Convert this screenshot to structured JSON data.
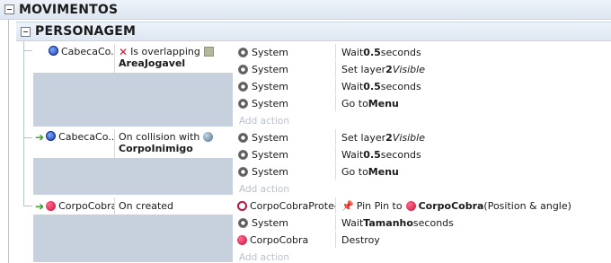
{
  "groups": {
    "main_title": "MOVIMENTOS",
    "sub_title": "PERSONAGEM"
  },
  "events": [
    {
      "object": "CabecaCo...",
      "icon": "blue-sprite-icon",
      "trigger": false,
      "condition_prefix": "Is overlapping",
      "condition_target": "AreaJogavel",
      "condition_icon": "x-icon",
      "target_icon": "sprite-thumbnail-icon",
      "actions": [
        {
          "object": "System",
          "icon": "gear-icon",
          "text_a": "Wait ",
          "bold": "0.5",
          "text_b": " seconds",
          "italic": ""
        },
        {
          "object": "System",
          "icon": "gear-icon",
          "text_a": "Set layer ",
          "bold": "2",
          "text_b": " ",
          "italic": "Visible"
        },
        {
          "object": "System",
          "icon": "gear-icon",
          "text_a": "Wait ",
          "bold": "0.5",
          "text_b": " seconds",
          "italic": ""
        },
        {
          "object": "System",
          "icon": "gear-icon",
          "text_a": "Go to ",
          "bold": "Menu",
          "text_b": "",
          "italic": ""
        }
      ],
      "add_action": "Add action"
    },
    {
      "object": "CabecaCo...",
      "icon": "blue-sprite-icon",
      "trigger": true,
      "condition_prefix": "On collision with",
      "condition_target": "CorpoInimigo",
      "target_icon": "globe-icon",
      "actions": [
        {
          "object": "System",
          "icon": "gear-icon",
          "text_a": "Set layer ",
          "bold": "2",
          "text_b": " ",
          "italic": "Visible"
        },
        {
          "object": "System",
          "icon": "gear-icon",
          "text_a": "Wait ",
          "bold": "0.5",
          "text_b": " seconds",
          "italic": ""
        },
        {
          "object": "System",
          "icon": "gear-icon",
          "text_a": "Go to ",
          "bold": "Menu",
          "text_b": "",
          "italic": ""
        }
      ],
      "add_action": "Add action"
    },
    {
      "object": "CorpoCobra",
      "icon": "red-sprite-icon",
      "trigger": true,
      "condition_prefix": "On created",
      "actions": [
        {
          "object": "CorpoCobraProtec...",
          "icon": "red-outline-icon",
          "pin_label": "Pin Pin to",
          "pin_target": "CorpoCobra",
          "pin_suffix": " (Position & angle)"
        },
        {
          "object": "System",
          "icon": "gear-icon",
          "text_a": "Wait ",
          "bold": "Tamanho",
          "text_b": " seconds",
          "italic": ""
        },
        {
          "object": "CorpoCobra",
          "icon": "red-sprite-icon",
          "text_a": "Destroy",
          "bold": "",
          "text_b": "",
          "italic": ""
        }
      ],
      "add_action": "Add action"
    }
  ]
}
